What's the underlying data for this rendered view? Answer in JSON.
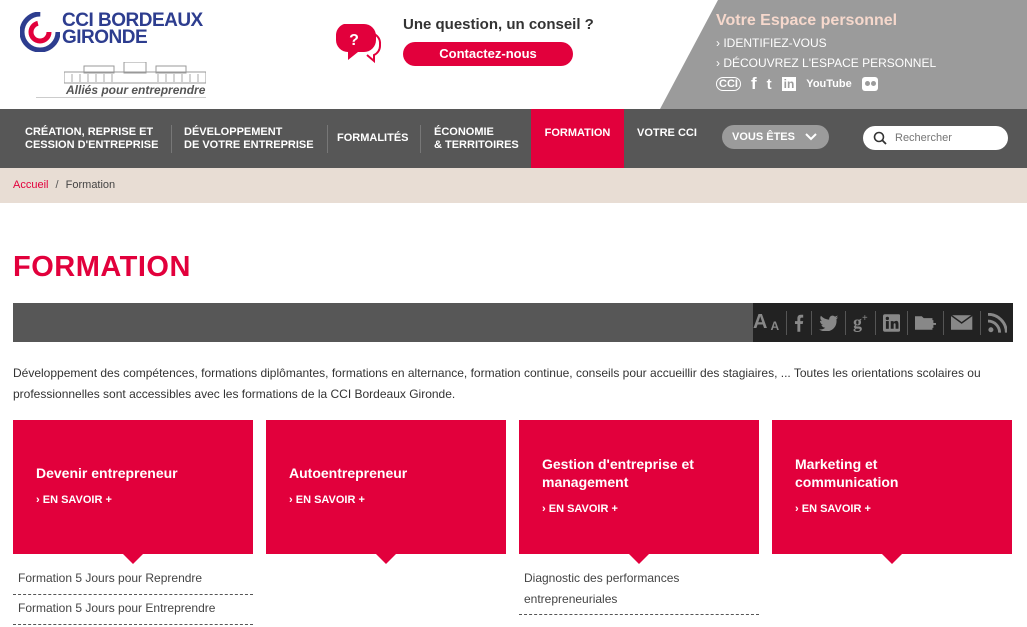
{
  "header": {
    "logo_line1": "CCI BORDEAUX",
    "logo_line2": "GIRONDE",
    "tagline": "Alliés pour entreprendre",
    "question_title": "Une question, un conseil ?",
    "contact_label": "Contactez-nous",
    "espace": {
      "title": "Votre Espace personnel",
      "link1": "IDENTIFIEZ-VOUS",
      "link2": "DÉCOUVREZ L'ESPACE PERSONNEL",
      "social": [
        "CCI",
        "f",
        "t",
        "in",
        "YouTube",
        "flickr"
      ]
    }
  },
  "nav": {
    "items": [
      {
        "label1": "CRÉATION, REPRISE ET",
        "label2": "CESSION D'ENTREPRISE"
      },
      {
        "label1": "DÉVELOPPEMENT",
        "label2": "DE VOTRE ENTREPRISE"
      },
      {
        "label1": "FORMALITÉS",
        "label2": ""
      },
      {
        "label1": "ÉCONOMIE",
        "label2": "& TERRITOIRES"
      },
      {
        "label1": "FORMATION",
        "label2": ""
      },
      {
        "label1": "VOTRE CCI",
        "label2": ""
      }
    ],
    "vous_etes": "VOUS ÊTES",
    "search_placeholder": "Rechercher"
  },
  "breadcrumb": {
    "home": "Accueil",
    "separator": "/",
    "current": "Formation"
  },
  "main": {
    "title": "FORMATION",
    "tools": {
      "font_large": "A",
      "font_small": "A"
    },
    "intro": "Développement des compétences, formations diplômantes, formations en alternance, formation continue, conseils pour accueillir des stagiaires, ... Toutes les orientations scolaires ou professionnelles sont accessibles avec les formations de la CCI Bordeaux Gironde.",
    "cards": [
      {
        "title": "Devenir entrepreneur",
        "link": "EN SAVOIR +",
        "subs": [
          "Formation 5 Jours pour Reprendre",
          "Formation 5 Jours pour Entreprendre"
        ]
      },
      {
        "title": "Autoentrepreneur",
        "link": "EN SAVOIR +",
        "subs": []
      },
      {
        "title": "Gestion d'entreprise et management",
        "link": "EN SAVOIR +",
        "subs": [
          "Diagnostic des performances entrepreneuriales"
        ]
      },
      {
        "title": "Marketing et communication",
        "link": "EN SAVOIR +",
        "subs": []
      }
    ]
  },
  "colors": {
    "accent": "#e2003c",
    "brand_blue": "#2d3d8f",
    "nav_bg": "#575757",
    "breadcrumb_bg": "#e8ddd4"
  }
}
